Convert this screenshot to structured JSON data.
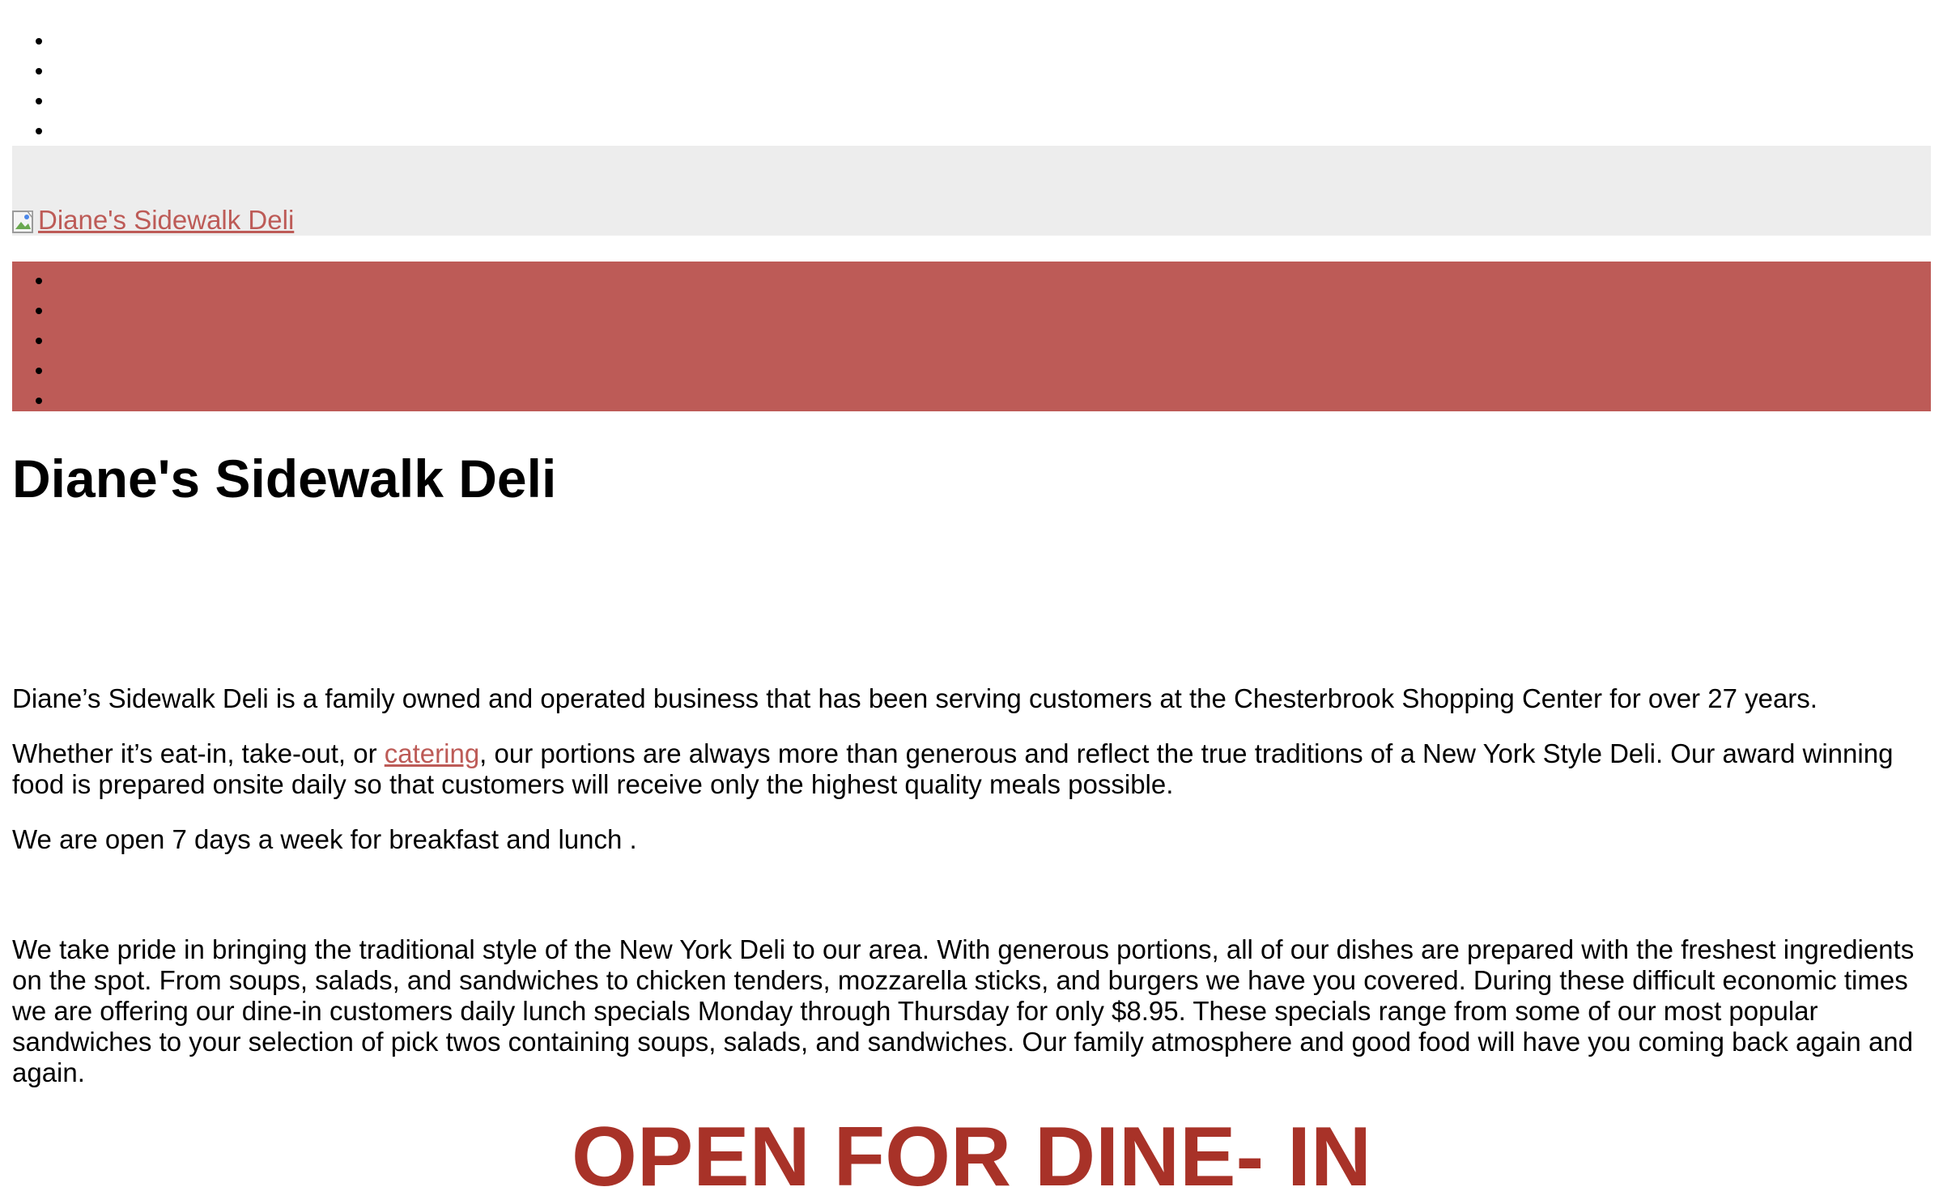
{
  "top_nav": {
    "items": [
      "",
      "",
      "",
      ""
    ]
  },
  "logo": {
    "alt_text": "Diane's Sidewalk Deli"
  },
  "main_nav": {
    "items": [
      "",
      "",
      "",
      "",
      ""
    ]
  },
  "site_title": "Diane's Sidewalk Deli",
  "content": {
    "p1": "Diane’s Sidewalk Deli is a family owned and operated business that has been serving customers at the Chesterbrook Shopping Center for over 27 years.",
    "p2_before": "Whether it’s eat-in, take-out, or ",
    "p2_link": "catering",
    "p2_after": ", our portions are always more than generous and reflect the true traditions of a New York Style Deli. Our award winning food is prepared onsite daily so that customers will receive only the highest quality meals possible.",
    "p3": "We are open 7 days a week for breakfast and lunch .",
    "p4": "We take pride in bringing the traditional style of the New York Deli to our area. With generous portions, all of our dishes are prepared with the freshest ingredients on the spot. From soups, salads, and sandwiches to chicken tenders, mozzarella sticks, and burgers we have you covered. During these difficult economic times we are offering our dine-in customers daily lunch specials Monday through Thursday for only $8.95. These specials range from some of our most popular sandwiches to your selection of pick twos containing soups, salads, and sandwiches. Our family atmosphere and good food will have you coming back again and again."
  },
  "promo": "OPEN FOR DINE- IN",
  "colors": {
    "accent": "#bd5b57",
    "logo_bar_bg": "#ededed",
    "promo_text": "#a83228"
  }
}
